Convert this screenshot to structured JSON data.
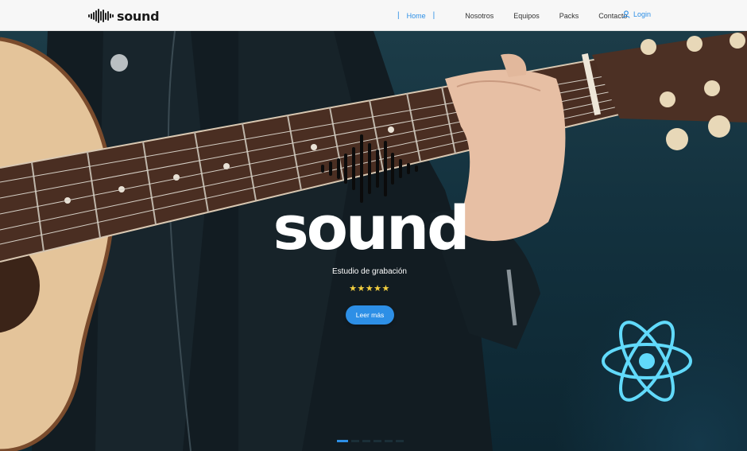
{
  "brand": {
    "name": "sound"
  },
  "nav": {
    "items": [
      {
        "label": "Home",
        "active": true
      },
      {
        "label": "Nosotros",
        "active": false
      },
      {
        "label": "Equipos",
        "active": false
      },
      {
        "label": "Packs",
        "active": false
      },
      {
        "label": "Contacto",
        "active": false
      }
    ],
    "login_label": "Login"
  },
  "hero": {
    "title": "sound",
    "subtitle": "Estudio de grabación",
    "rating": "★★★★★",
    "button_label": "Leer más",
    "slides": 6,
    "active_slide": 1
  },
  "colors": {
    "accent": "#2d8fe6",
    "stars": "#f4d03f",
    "react": "#61dafb"
  },
  "icons": [
    "soundwave-icon",
    "user-icon",
    "react-icon"
  ]
}
